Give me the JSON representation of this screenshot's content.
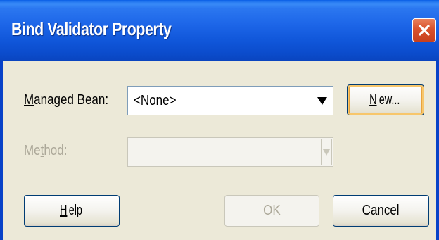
{
  "dialog": {
    "title": "Bind Validator Property",
    "close_icon": "close-icon"
  },
  "managed_bean": {
    "label_mnemonic": "M",
    "label_rest": "anaged Bean:",
    "value": "<None>"
  },
  "method": {
    "label_pre": "Me",
    "label_mnemonic": "t",
    "label_post": "hod:",
    "value": ""
  },
  "buttons": {
    "new_mnemonic": "N",
    "new_rest": "ew...",
    "help_mnemonic": "H",
    "help_rest": "elp",
    "ok": "OK",
    "cancel": "Cancel"
  },
  "colors": {
    "titlebar": "#0f55d8",
    "close": "#d9512c",
    "face": "#ece9d8"
  }
}
